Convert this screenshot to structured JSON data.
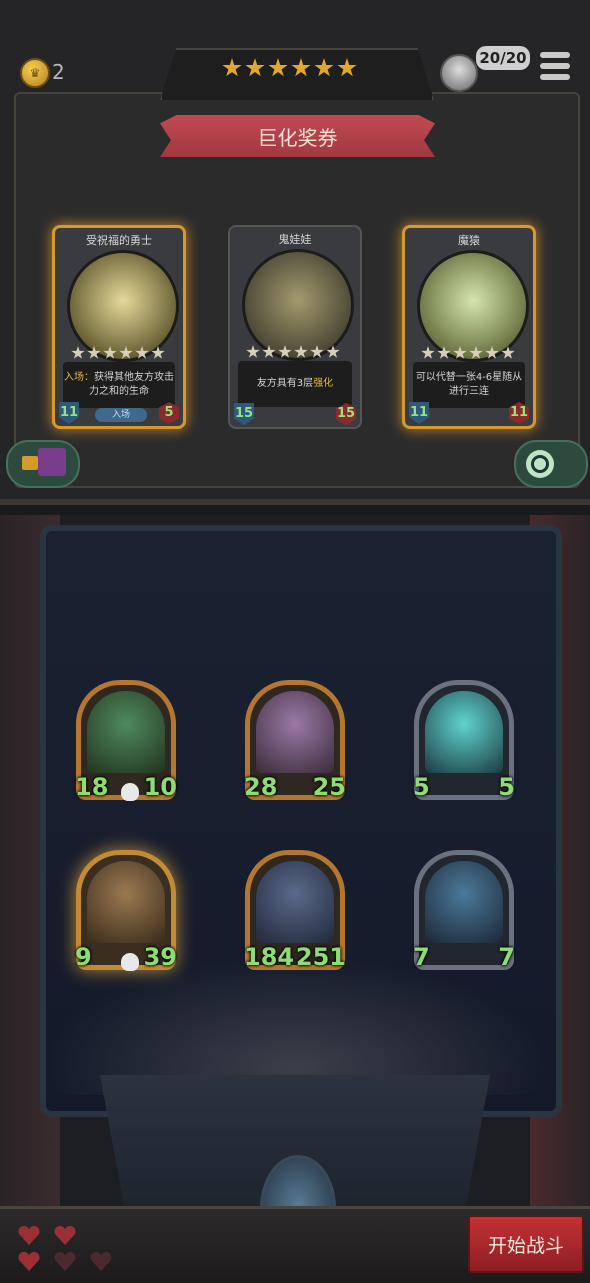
{
  "currency": {
    "coins": "2",
    "icon": "crown-coin-icon"
  },
  "stars": {
    "count": 6
  },
  "player": {
    "hp": "20/20"
  },
  "shop": {
    "title": "巨化奖券",
    "cards": [
      {
        "name": "受祝福的勇士",
        "stars": 6,
        "desc_hl": "入场：",
        "desc": "获得其他友方攻击力之和的生命",
        "keyword": "入场",
        "atk": "11",
        "hp": "5",
        "highlight": true
      },
      {
        "name": "鬼娃娃",
        "stars": 6,
        "desc_pre": "友方具有3层",
        "desc_hl": "强化",
        "atk": "15",
        "hp": "15",
        "highlight": false
      },
      {
        "name": "魔猿",
        "stars": 6,
        "desc": "可以代替一张4-6星随从进行三连",
        "atk": "11",
        "hp": "11",
        "highlight": true
      }
    ]
  },
  "board": {
    "minions": [
      {
        "atk": "18",
        "hp": "10",
        "frame": "bronze",
        "skull": true
      },
      {
        "atk": "28",
        "hp": "25",
        "frame": "bronze",
        "skull": false
      },
      {
        "atk": "5",
        "hp": "5",
        "frame": "silver",
        "skull": false
      },
      {
        "atk": "9",
        "hp": "39",
        "frame": "golden",
        "skull": true
      },
      {
        "atk": "184",
        "hp": "251",
        "frame": "bronze",
        "skull": false
      },
      {
        "atk": "7",
        "hp": "7",
        "frame": "silver",
        "skull": false
      }
    ]
  },
  "lives": {
    "full": 3,
    "total": 5
  },
  "start_button": "开始战斗",
  "colors": {
    "accent_red": "#c43234",
    "gold": "#d59a2f",
    "stat_green": "#8fdc77"
  }
}
